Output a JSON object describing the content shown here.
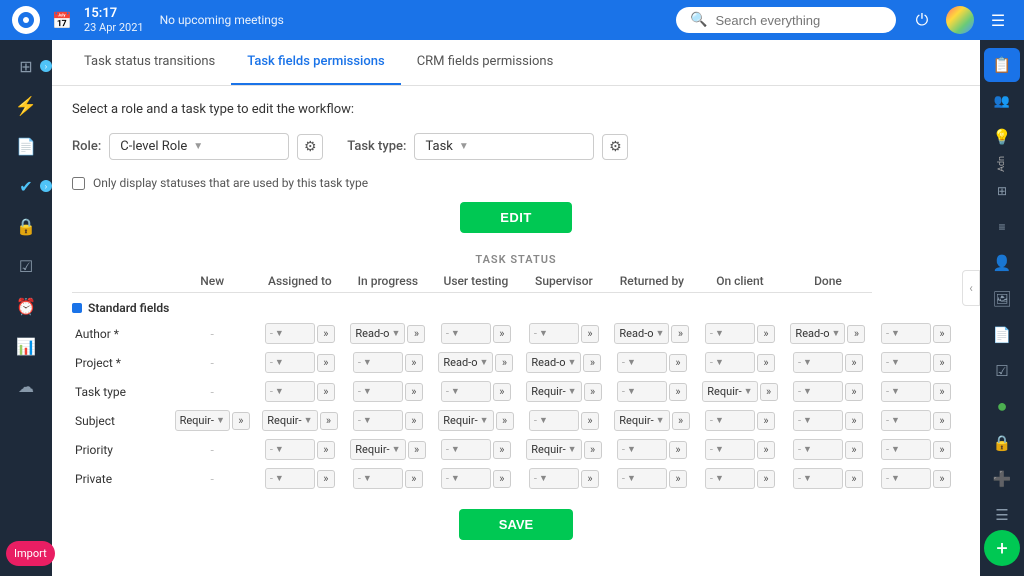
{
  "topbar": {
    "time": "15:17",
    "date": "23 Apr 2021",
    "meeting": "No upcoming meetings",
    "search_placeholder": "Search everything"
  },
  "tabs": [
    {
      "id": "task-status",
      "label": "Task status transitions",
      "active": false
    },
    {
      "id": "task-fields",
      "label": "Task fields permissions",
      "active": true
    },
    {
      "id": "crm-fields",
      "label": "CRM fields permissions",
      "active": false
    }
  ],
  "instruction": "Select a role and a task type to edit the workflow:",
  "role_label": "Role:",
  "role_value": "C-level Role",
  "task_type_label": "Task type:",
  "task_type_value": "Task",
  "checkbox_label": "Only display statuses that are used by this task type",
  "edit_button": "EDIT",
  "save_button": "SAVE",
  "task_status_label": "TASK STATUS",
  "columns": [
    "",
    "New",
    "Assigned to",
    "In progress",
    "User testing",
    "Supervisor",
    "Returned by",
    "On client",
    "Done"
  ],
  "section_label": "Standard fields",
  "fields": [
    {
      "name": "Author *",
      "values": [
        "",
        "",
        "Read-o",
        "",
        "",
        "Read-o",
        "",
        "Read-o",
        ""
      ]
    },
    {
      "name": "Project *",
      "values": [
        "",
        "",
        "",
        "Read-o",
        "Read-o",
        "",
        "",
        "",
        ""
      ]
    },
    {
      "name": "Task type",
      "values": [
        "",
        "",
        "",
        "",
        "Requir-",
        "",
        "Requir-",
        "",
        ""
      ]
    },
    {
      "name": "Subject",
      "values": [
        "Requir-",
        "Requir-",
        "",
        "Requir-",
        "",
        "Requir-",
        "",
        "",
        ""
      ]
    },
    {
      "name": "Priority",
      "values": [
        "",
        "",
        "Requir-",
        "",
        "Requir-",
        "",
        "",
        "",
        ""
      ]
    },
    {
      "name": "Private",
      "values": [
        "",
        "",
        "",
        "",
        "",
        "",
        "",
        "",
        ""
      ]
    }
  ],
  "sidebar_items": [
    {
      "icon": "⊞",
      "label": "grid"
    },
    {
      "icon": "⚡",
      "label": "lightning"
    },
    {
      "icon": "☰",
      "label": "list"
    },
    {
      "icon": "✔",
      "label": "check"
    },
    {
      "icon": "🔒",
      "label": "lock"
    },
    {
      "icon": "☑",
      "label": "checkbox"
    },
    {
      "icon": "⏰",
      "label": "clock"
    },
    {
      "icon": "📊",
      "label": "chart"
    },
    {
      "icon": "☁",
      "label": "cloud"
    }
  ],
  "right_items": [
    {
      "icon": "📋",
      "label": "clipboard",
      "active_green": true
    },
    {
      "icon": "👤",
      "label": "user-add"
    },
    {
      "icon": "💡",
      "label": "idea"
    },
    {
      "icon": "≡",
      "label": "menu"
    },
    {
      "icon": "⊞",
      "label": "grid2"
    },
    {
      "icon": "≡",
      "label": "list2"
    },
    {
      "icon": "👤",
      "label": "person"
    },
    {
      "icon": "🖼",
      "label": "image"
    },
    {
      "icon": "📄",
      "label": "file"
    },
    {
      "icon": "☑",
      "label": "check2"
    },
    {
      "icon": "●",
      "label": "dot"
    },
    {
      "icon": "🔒",
      "label": "lock2"
    },
    {
      "icon": "➕",
      "label": "plus-sm"
    },
    {
      "icon": "☰",
      "label": "lines"
    }
  ],
  "right_label": "Adn"
}
